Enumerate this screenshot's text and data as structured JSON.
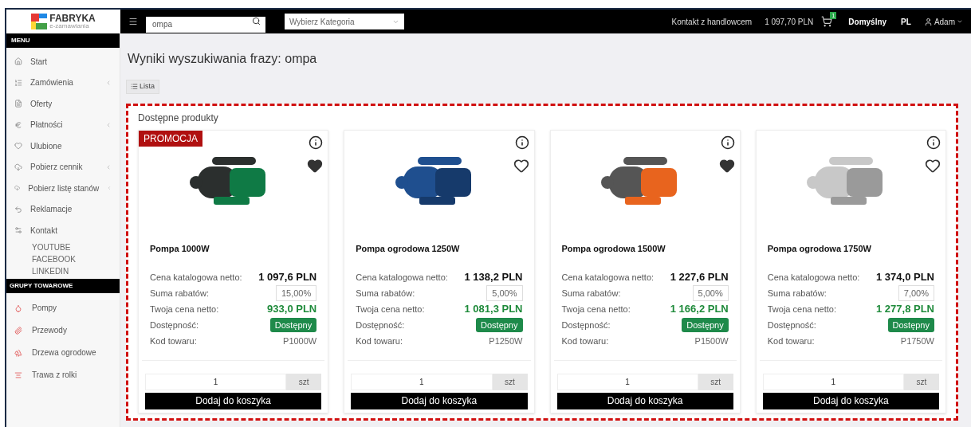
{
  "header": {
    "logo": {
      "name": "FABRYKA",
      "tagline": "e-zamawiania"
    },
    "search": {
      "value": "ompa"
    },
    "category": {
      "placeholder": "Wybierz Kategoria"
    },
    "contact": "Kontakt z handlowcem",
    "cart_total": "1 097,70 PLN",
    "cart_count": "1",
    "price_list": "Domyślny",
    "language": "PL",
    "user": "Adam"
  },
  "sidebar": {
    "menu_title": "MENU",
    "items": [
      {
        "label": "Start",
        "submenu": false
      },
      {
        "label": "Zamówienia",
        "submenu": true
      },
      {
        "label": "Oferty",
        "submenu": false
      },
      {
        "label": "Płatności",
        "submenu": true
      },
      {
        "label": "Ulubione",
        "submenu": false
      },
      {
        "label": "Pobierz cennik",
        "submenu": true
      },
      {
        "label": "Pobierz listę stanów",
        "submenu": true
      },
      {
        "label": "Reklamacje",
        "submenu": false
      },
      {
        "label": "Kontakt",
        "submenu": false
      }
    ],
    "links": [
      "YOUTUBE",
      "FACEBOOK",
      "LINKEDIN"
    ],
    "groups_title": "GRUPY TOWAROWE",
    "groups": [
      "Pompy",
      "Przewody",
      "Drzewa ogrodowe",
      "Trawa z rolki"
    ]
  },
  "page_title": "Wyniki wyszukiwania frazy: ompa",
  "view_button": "Lista",
  "panel_title": "Dostępne produkty",
  "products": [
    {
      "badge": "PROMOCJA",
      "favorite": true,
      "name": "Pompa 1000W",
      "catalog_label": "Cena katalogowa netto:",
      "catalog_price": "1 097,6 PLN",
      "discount_label": "Suma rabatów:",
      "discount": "15,00%",
      "net_label": "Twoja cena netto:",
      "net_price": "933,0 PLN",
      "availability_label": "Dostępność:",
      "availability": "Dostępny",
      "code_label": "Kod towaru:",
      "code": "P1000W",
      "quantity": "1",
      "unit": "szt",
      "add_button": "Dodaj do koszyka"
    },
    {
      "favorite": false,
      "name": "Pompa ogrodowa 1250W",
      "catalog_label": "Cena katalogowa netto:",
      "catalog_price": "1 138,2 PLN",
      "discount_label": "Suma rabatów:",
      "discount": "5,00%",
      "net_label": "Twoja cena netto:",
      "net_price": "1 081,3 PLN",
      "availability_label": "Dostępność:",
      "availability": "Dostępny",
      "code_label": "Kod towaru:",
      "code": "P1250W",
      "quantity": "1",
      "unit": "szt",
      "add_button": "Dodaj do koszyka"
    },
    {
      "favorite": true,
      "name": "Pompa ogrodowa 1500W",
      "catalog_label": "Cena katalogowa netto:",
      "catalog_price": "1 227,6 PLN",
      "discount_label": "Suma rabatów:",
      "discount": "5,00%",
      "net_label": "Twoja cena netto:",
      "net_price": "1 166,2 PLN",
      "availability_label": "Dostępność:",
      "availability": "Dostępny",
      "code_label": "Kod towaru:",
      "code": "P1500W",
      "quantity": "1",
      "unit": "szt",
      "add_button": "Dodaj do koszyka"
    },
    {
      "favorite": false,
      "name": "Pompa ogrodowa 1750W",
      "catalog_label": "Cena katalogowa netto:",
      "catalog_price": "1 374,0 PLN",
      "discount_label": "Suma rabatów:",
      "discount": "7,00%",
      "net_label": "Twoja cena netto:",
      "net_price": "1 277,8 PLN",
      "availability_label": "Dostępność:",
      "availability": "Dostępny",
      "code_label": "Kod towaru:",
      "code": "P1750W",
      "quantity": "1",
      "unit": "szt",
      "add_button": "Dodaj do koszyka"
    }
  ]
}
